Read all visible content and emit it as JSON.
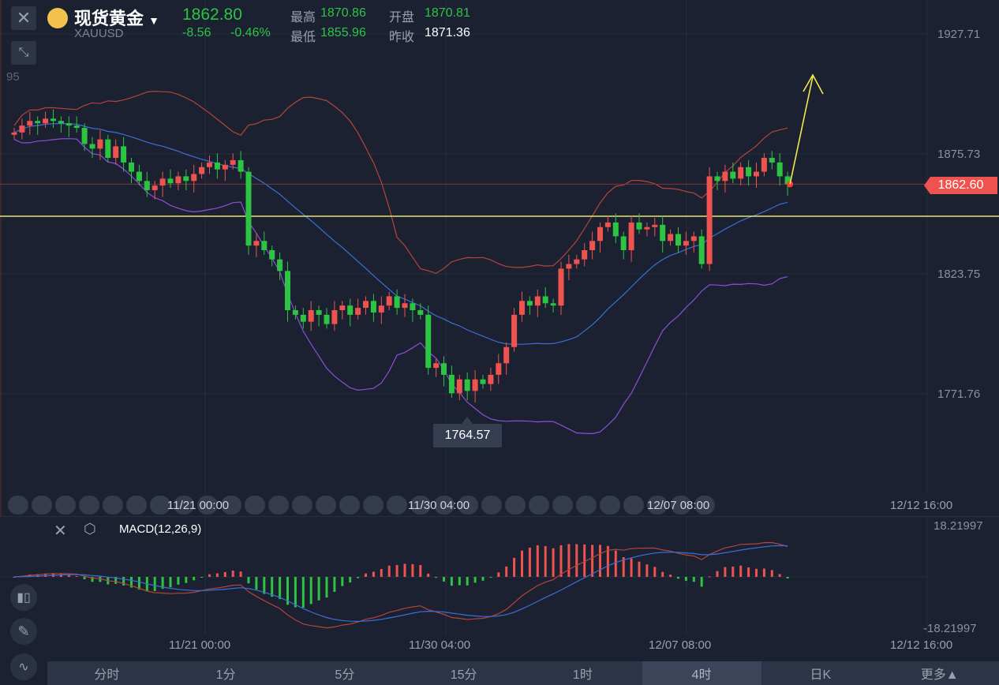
{
  "header": {
    "name": "现货黄金",
    "symbol": "XAUUSD",
    "price": "1862.80",
    "change": "-8.56",
    "change_pct": "-0.46%",
    "high_label": "最高",
    "high": "1870.86",
    "open_label": "开盘",
    "open": "1870.81",
    "low_label": "最低",
    "low": "1855.96",
    "prev_label": "昨收",
    "prev_close": "1871.36",
    "left_partial_label": "95"
  },
  "colors": {
    "up": "#ef5350",
    "down": "#2dc443",
    "boll_mid": "#3b6fd6",
    "boll_upper": "#b5443a",
    "boll_lower": "#8a4fd8",
    "support_line": "#e8e36a",
    "arrow": "#f2e94e",
    "dif": "#b5443a",
    "dea": "#3b6fd6"
  },
  "chart_data": [
    {
      "type": "candlestick",
      "indicators": [
        "BOLL"
      ],
      "y_ticks": [
        "1927.71",
        "1875.73",
        "1823.75",
        "1771.76"
      ],
      "ylim": [
        1927.71,
        1771.76
      ],
      "x_ticks": [
        "11/21 00:00",
        "11/30 04:00",
        "12/07 08:00",
        "12/12 16:00"
      ],
      "last_price_label": "1862.60",
      "low_marker": "1764.57",
      "support_level": 1848.7,
      "close": [
        1885,
        1888,
        1890,
        1889,
        1891,
        1890,
        1889,
        1888,
        1887,
        1880,
        1878,
        1882,
        1874,
        1879,
        1872,
        1868,
        1864,
        1860,
        1862,
        1865,
        1863,
        1866,
        1864,
        1867,
        1870,
        1872,
        1869,
        1871,
        1873,
        1868,
        1836,
        1838,
        1834,
        1830,
        1825,
        1808,
        1806,
        1803,
        1808,
        1806,
        1802,
        1808,
        1810,
        1806,
        1809,
        1812,
        1807,
        1810,
        1814,
        1809,
        1811,
        1808,
        1806,
        1783,
        1785,
        1780,
        1772,
        1778,
        1773,
        1778,
        1776,
        1780,
        1785,
        1792,
        1806,
        1812,
        1810,
        1814,
        1811,
        1810,
        1826,
        1828,
        1830,
        1834,
        1838,
        1844,
        1846,
        1840,
        1834,
        1846,
        1843,
        1844,
        1845,
        1838,
        1841,
        1836,
        1838,
        1840,
        1828,
        1866,
        1864,
        1868,
        1865,
        1870,
        1866,
        1868,
        1874,
        1872,
        1866,
        1862.6
      ]
    },
    {
      "type": "macd",
      "title": "MACD(12,26,9)",
      "y_ticks": [
        "18.21997",
        "-18.21997"
      ],
      "ylim": [
        -18.21997,
        18.21997
      ],
      "x_ticks": [
        "11/21 00:00",
        "11/30 04:00",
        "12/07 08:00",
        "12/12 16:00"
      ]
    }
  ],
  "tabs": [
    "分时",
    "1分",
    "5分",
    "15分",
    "1时",
    "4时",
    "日K",
    "更多▲"
  ],
  "selected_tab": "4时"
}
